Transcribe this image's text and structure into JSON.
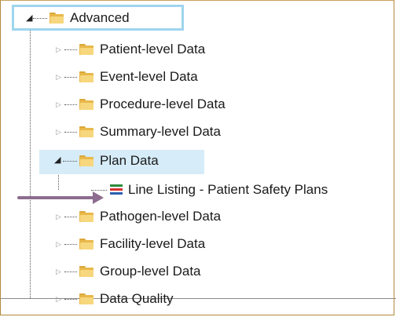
{
  "tree": {
    "root": {
      "label": "Advanced",
      "icon": "folder-icon",
      "expanded": true
    },
    "children": [
      {
        "label": "Patient-level Data",
        "icon": "folder-icon",
        "expanded": false
      },
      {
        "label": "Event-level Data",
        "icon": "folder-icon",
        "expanded": false
      },
      {
        "label": "Procedure-level Data",
        "icon": "folder-icon",
        "expanded": false
      },
      {
        "label": "Summary-level Data",
        "icon": "folder-icon",
        "expanded": false
      },
      {
        "label": "Plan Data",
        "icon": "folder-icon",
        "expanded": true,
        "children": [
          {
            "label": "Line Listing - Patient Safety Plans",
            "icon": "line-listing-icon"
          }
        ]
      },
      {
        "label": "Pathogen-level Data",
        "icon": "folder-icon",
        "expanded": false
      },
      {
        "label": "Facility-level Data",
        "icon": "folder-icon",
        "expanded": false
      },
      {
        "label": "Group-level Data",
        "icon": "folder-icon",
        "expanded": false
      },
      {
        "label": "Data Quality",
        "icon": "folder-icon",
        "expanded": false
      }
    ]
  },
  "colors": {
    "selection_border": "#9fd5ee",
    "selection_fill": "#d6ecf8",
    "annotation_arrow": "#8d6c8f",
    "folder": "#f7d77d"
  }
}
